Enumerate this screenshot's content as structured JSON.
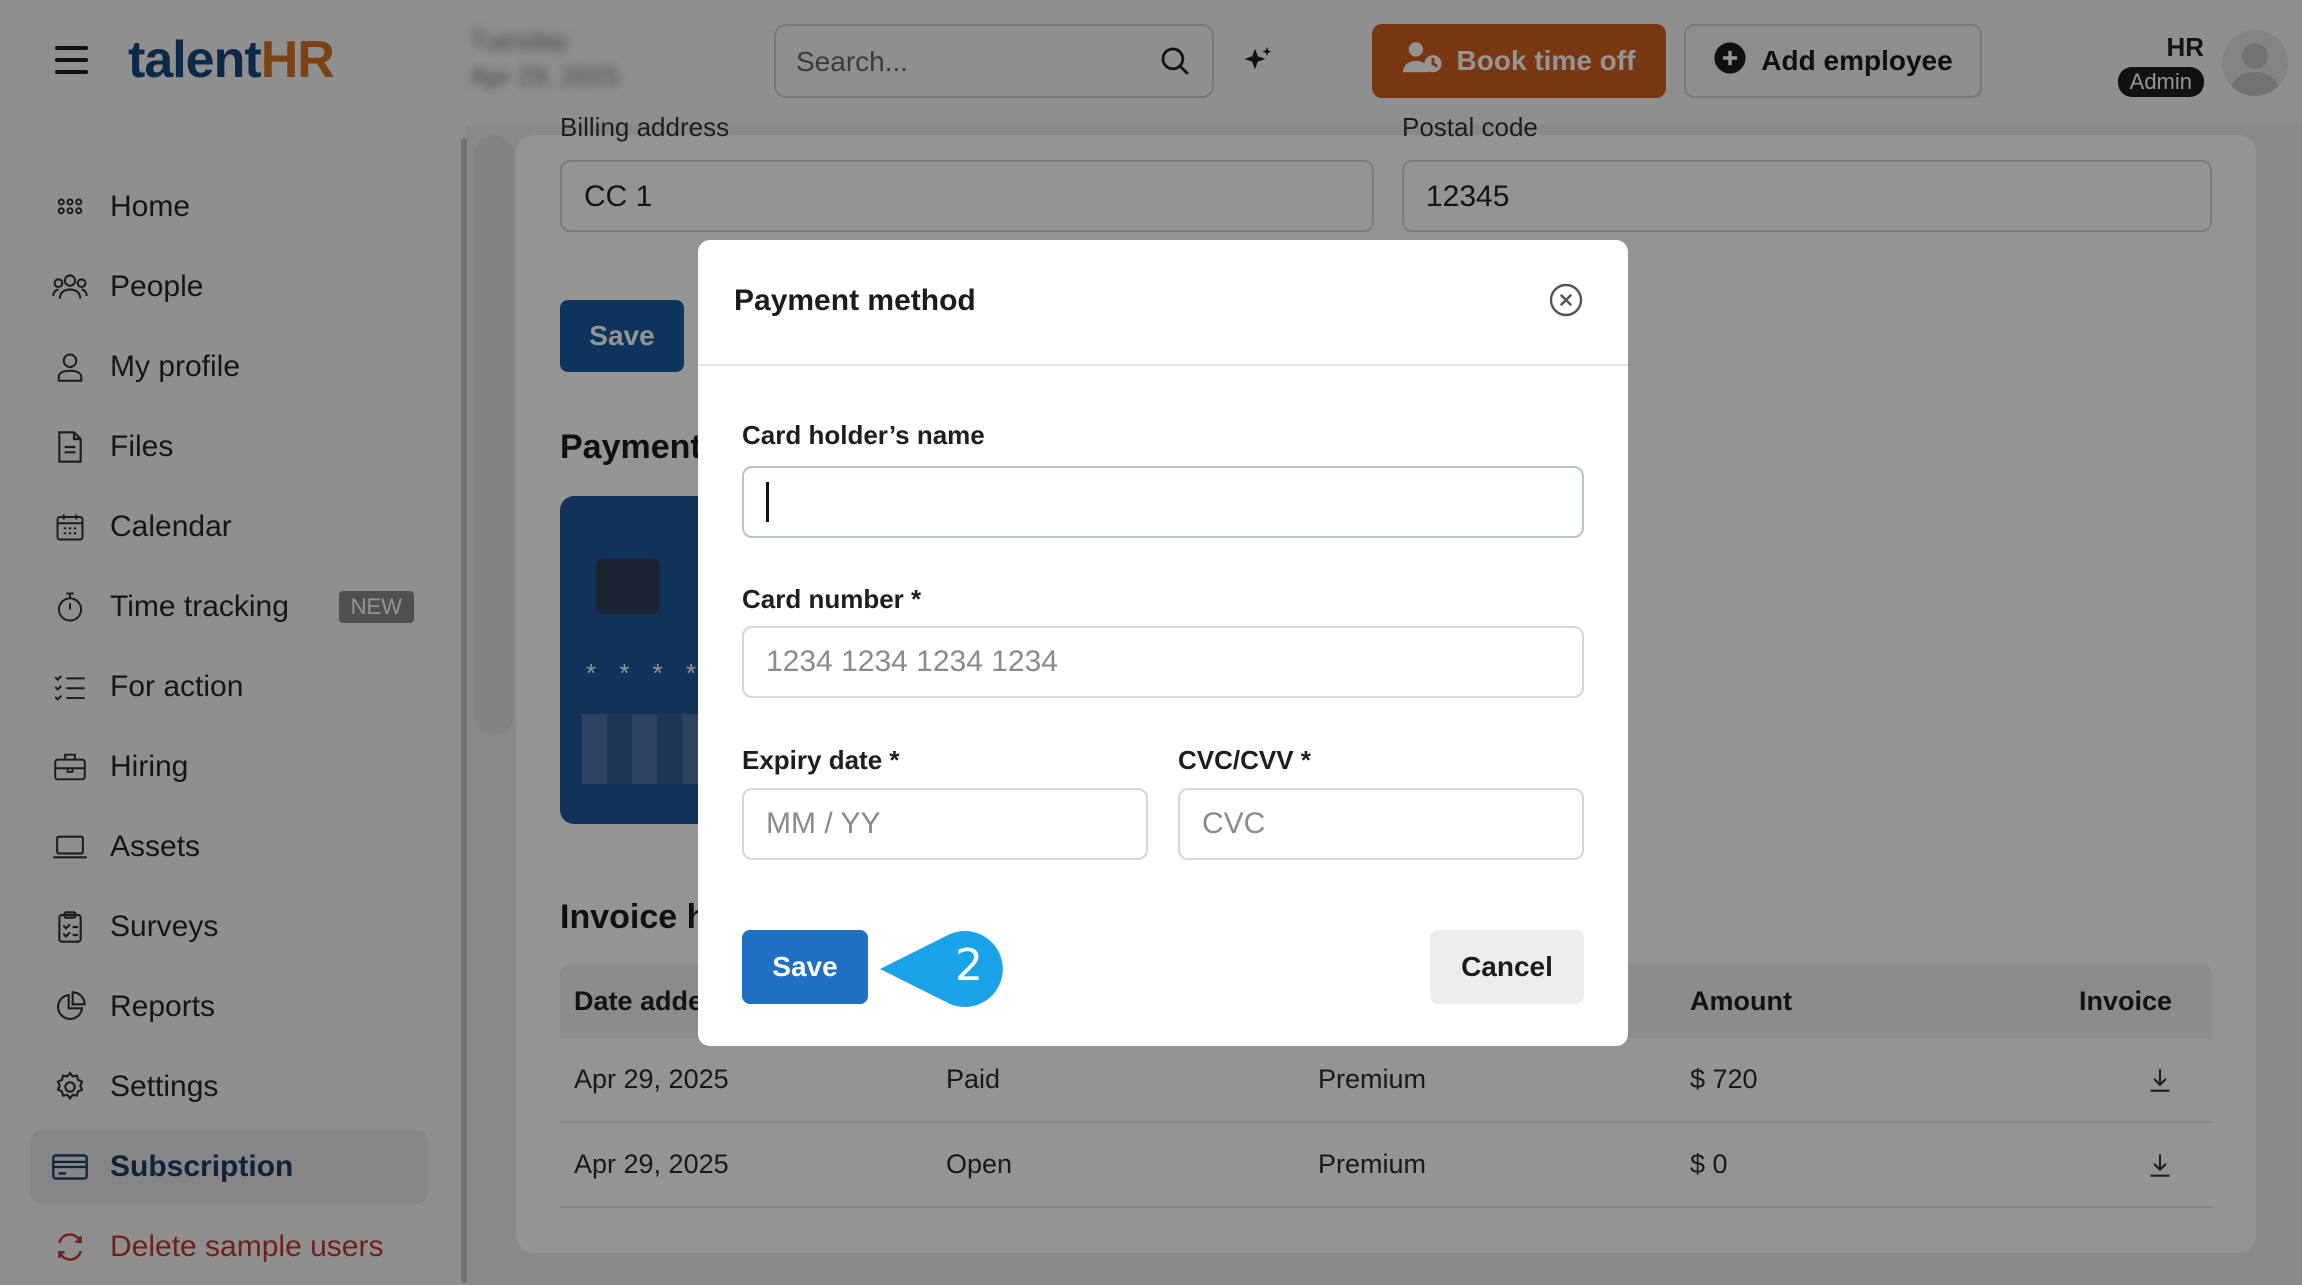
{
  "app": {
    "logo_part1": "talent",
    "logo_part2": "HR"
  },
  "header": {
    "date_line1": "Tuesday",
    "date_line2": "Apr 29, 2025",
    "search_placeholder": "Search...",
    "book_time_off": "Book time off",
    "add_employee": "Add employee",
    "user_initials": "HR",
    "user_role": "Admin"
  },
  "sidebar": {
    "items": [
      {
        "label": "Home",
        "icon": "grid-icon"
      },
      {
        "label": "People",
        "icon": "people-icon"
      },
      {
        "label": "My profile",
        "icon": "person-icon"
      },
      {
        "label": "Files",
        "icon": "file-icon"
      },
      {
        "label": "Calendar",
        "icon": "calendar-icon"
      },
      {
        "label": "Time tracking",
        "icon": "stopwatch-icon",
        "badge": "NEW"
      },
      {
        "label": "For action",
        "icon": "checklist-icon"
      },
      {
        "label": "Hiring",
        "icon": "briefcase-icon"
      },
      {
        "label": "Assets",
        "icon": "laptop-icon"
      },
      {
        "label": "Surveys",
        "icon": "clipboard-icon"
      },
      {
        "label": "Reports",
        "icon": "pie-chart-icon"
      },
      {
        "label": "Settings",
        "icon": "gear-icon"
      },
      {
        "label": "Subscription",
        "icon": "credit-card-icon",
        "active": true
      },
      {
        "label": "Delete sample users",
        "icon": "refresh-icon",
        "danger": true
      }
    ]
  },
  "billing": {
    "billing_address_label": "Billing address",
    "billing_address_value": "CC 1",
    "postal_code_label": "Postal code",
    "postal_code_value": "12345",
    "save_label": "Save",
    "payment_title": "Payment",
    "card_masked": "* * * *"
  },
  "invoices": {
    "title": "Invoice h",
    "headers": [
      "Date adde",
      "",
      "",
      "Amount",
      "Invoice"
    ],
    "rows": [
      {
        "date": "Apr 29, 2025",
        "status": "Paid",
        "plan": "Premium",
        "amount": "$ 720"
      },
      {
        "date": "Apr 29, 2025",
        "status": "Open",
        "plan": "Premium",
        "amount": "$ 0"
      }
    ]
  },
  "modal": {
    "title": "Payment method",
    "cardholder_label": "Card holder’s name",
    "cardholder_value": "",
    "card_number_label": "Card number *",
    "card_number_placeholder": "1234 1234 1234 1234",
    "expiry_label": "Expiry date *",
    "expiry_placeholder": "MM / YY",
    "cvc_label": "CVC/CVV *",
    "cvc_placeholder": "CVC",
    "save_label": "Save",
    "cancel_label": "Cancel",
    "step_number": "2"
  },
  "colors": {
    "brand_blue": "#16487a",
    "brand_orange": "#d4721f",
    "book_button": "#cf5d1e",
    "primary_button": "#1f6fc2",
    "callout": "#1aa3e8",
    "danger_text": "#c0392b"
  }
}
